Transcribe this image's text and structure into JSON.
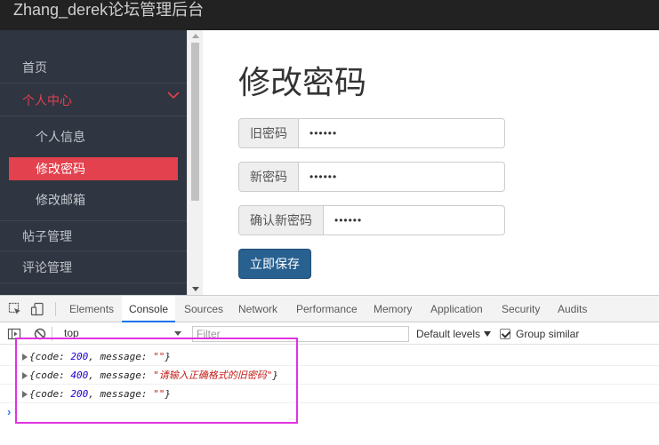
{
  "header": {
    "brand": "Zhang_derek论坛管理后台"
  },
  "sidebar": {
    "items": [
      {
        "label": "首页"
      },
      {
        "label": "个人中心"
      },
      {
        "label": "帖子管理"
      },
      {
        "label": "评论管理"
      }
    ],
    "subitems": [
      {
        "label": "个人信息"
      },
      {
        "label": "修改密码"
      },
      {
        "label": "修改邮箱"
      }
    ]
  },
  "main": {
    "title": "修改密码",
    "fields": [
      {
        "label": "旧密码",
        "value": "••••••"
      },
      {
        "label": "新密码",
        "value": "••••••"
      },
      {
        "label": "确认新密码",
        "value": "••••••"
      }
    ],
    "submit_label": "立即保存"
  },
  "devtools": {
    "tabs": [
      "Elements",
      "Console",
      "Sources",
      "Network",
      "Performance",
      "Memory",
      "Application",
      "Security",
      "Audits"
    ],
    "active_tab": "Console",
    "context": "top",
    "filter_placeholder": "Filter",
    "levels_label": "Default levels",
    "group_similar_label": "Group similar",
    "group_similar_checked": true,
    "logs": [
      {
        "prefix": "{code: ",
        "code": "200",
        "mid": ", message: ",
        "message": "\"\"",
        "suffix": "}"
      },
      {
        "prefix": "{code: ",
        "code": "400",
        "mid": ", message: ",
        "message": "\"请输入正确格式的旧密码\"",
        "suffix": "}"
      },
      {
        "prefix": "{code: ",
        "code": "200",
        "mid": ", message: ",
        "message": "\"\"",
        "suffix": "}"
      }
    ],
    "prompt": "›"
  },
  "colors": {
    "topbar": "#222222",
    "sidebar": "#2f3541",
    "accent": "#e3414d",
    "primary_button": "#286090",
    "highlight_box": "#e032e0"
  }
}
